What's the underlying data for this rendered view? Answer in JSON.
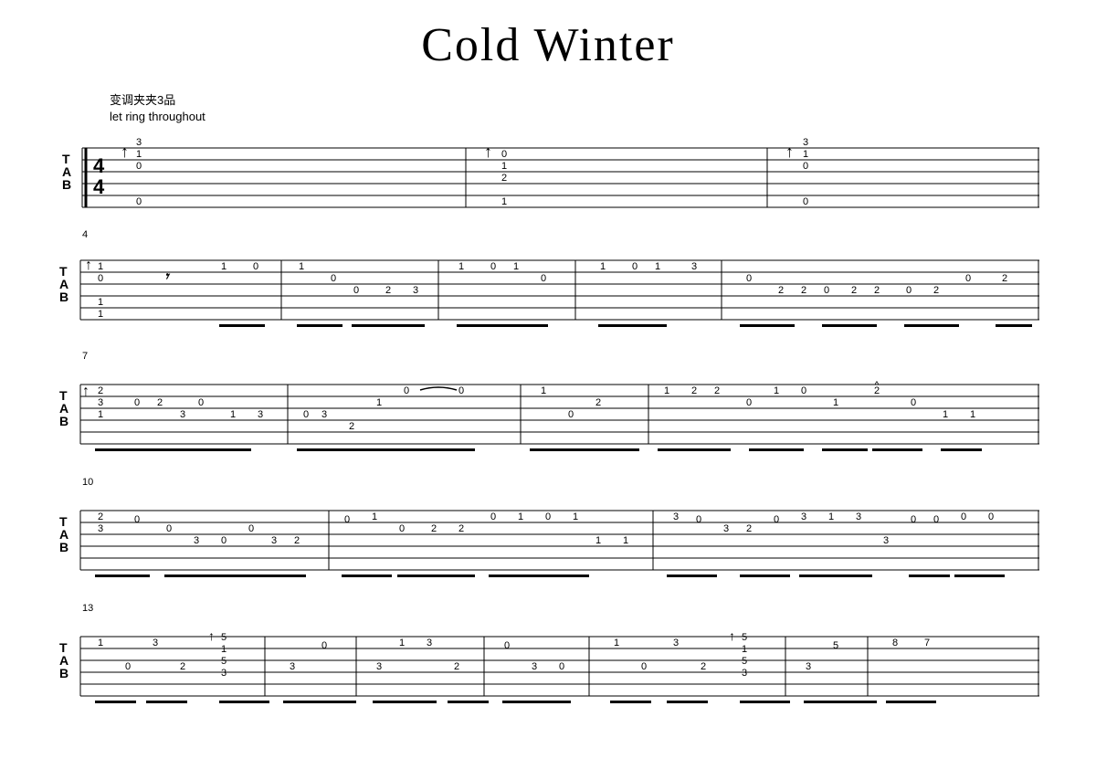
{
  "title": "Cold Winter",
  "meta": {
    "capo": "变调夹夹3品",
    "instruction": "let ring throughout"
  },
  "colors": {
    "primary": "#000000",
    "background": "#ffffff"
  }
}
